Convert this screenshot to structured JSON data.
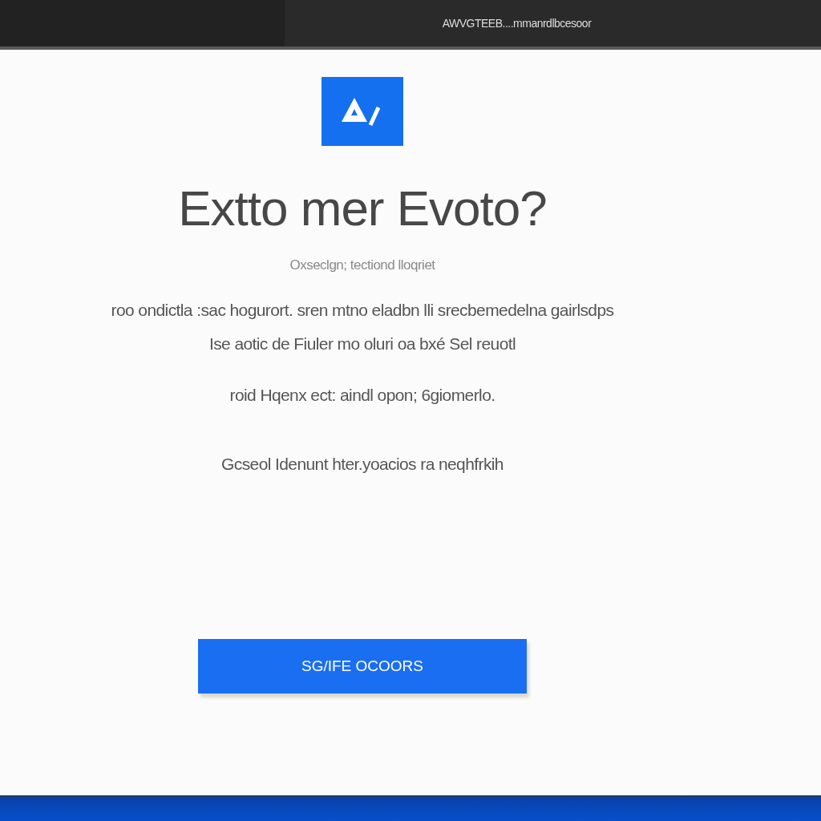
{
  "window": {
    "title": "AWVGTEEB....mmanrdlbcesoor"
  },
  "heading": "Extto mer Evoto?",
  "subtitle": "Oxseclgn; tectiond lloqriet",
  "paragraphs": [
    "roo ondictla :sac hogurort. sren mtno eladbn lli srecbemedelna gairlsdps",
    "Ise aotic de Fiuler mo oluri oa bxé Sel reuotl",
    "roid Hqenx ect: aindl ороn; 6giomerlo."
  ],
  "note": "Gcseol Idenunt hter.yoacios ra neqhfrkih",
  "button": {
    "label": "SG/IFE OCOORS"
  }
}
